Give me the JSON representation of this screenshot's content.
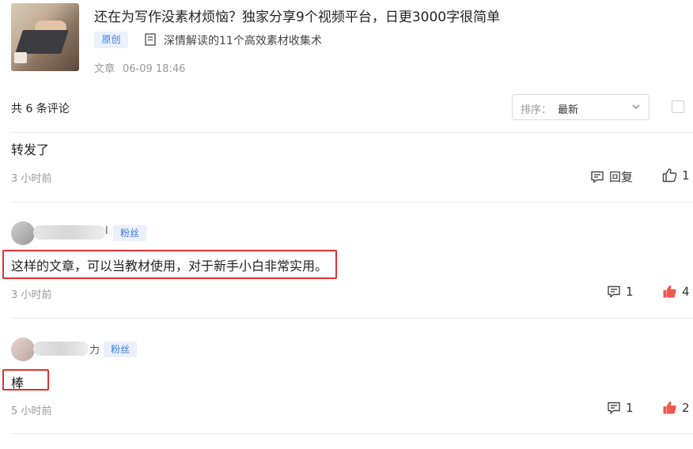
{
  "article": {
    "title": "还在为写作没素材烦恼？独家分享9个视频平台，日更3000字很简单",
    "tag": "原创",
    "collection": "深情解读的11个高效素材收集术",
    "type": "文章",
    "date": "06-09 18:46"
  },
  "comment_bar": {
    "count_text": "共 6 条评论",
    "sort_label": "排序：",
    "sort_value": "最新"
  },
  "comments": [
    {
      "text": "转发了",
      "time": "3 小时前",
      "reply_label": "回复",
      "like_count": "1",
      "liked": false
    },
    {
      "user_tail": "l",
      "badge": "粉丝",
      "text": "这样的文章，可以当教材使用，对于新手小白非常实用。",
      "time": "3 小时前",
      "reply_count": "1",
      "like_count": "4",
      "liked": true
    },
    {
      "user_tail": "力",
      "badge": "粉丝",
      "text": "棒",
      "time": "5 小时前",
      "reply_count": "1",
      "like_count": "2",
      "liked": true
    }
  ],
  "colors": {
    "accent_blue": "#3e7ad8",
    "badge_bg": "#eaf1fd",
    "liked_red": "#f0574f",
    "highlight_red": "#e03131",
    "muted": "#999999"
  },
  "icons": {
    "collection": "bookmark-list-icon",
    "sort": "chevron-down-icon",
    "reply": "comment-bubble-icon",
    "like": "thumbs-up-icon"
  }
}
